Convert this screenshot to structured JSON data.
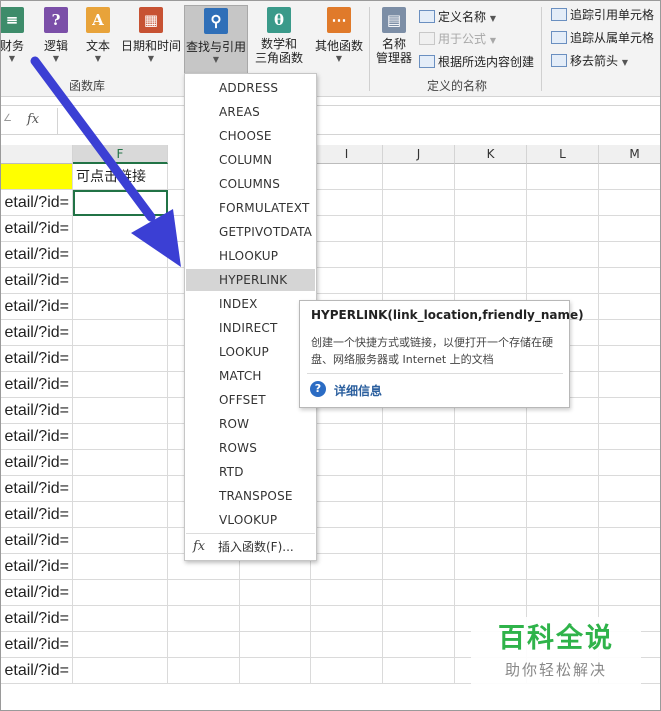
{
  "ribbon": {
    "finance_label": "财务",
    "logic_label": "逻辑",
    "text_label": "文本",
    "datetime_label": "日期和时间",
    "lookup_label": "查找与引用",
    "math_label_line1": "数学和",
    "math_label_line2": "三角函数",
    "more_label": "其他函数",
    "group_function_library": "函数库",
    "name_manager_line1": "名称",
    "name_manager_line2": "管理器",
    "define_name": "定义名称",
    "use_in_formula": "用于公式",
    "create_from_selection": "根据所选内容创建",
    "group_defined_names": "定义的名称",
    "trace_precedents": "追踪引用单元格",
    "trace_dependents": "追踪从属单元格",
    "remove_arrows": "移去箭头"
  },
  "formula_bar": {
    "fx_label": "fx"
  },
  "columns": [
    "F",
    "I",
    "J",
    "K",
    "L",
    "M"
  ],
  "header_cell": "可点击链接",
  "left_cell_text": "etail/?id=",
  "row_count": 20,
  "dropdown": {
    "items": [
      "ADDRESS",
      "AREAS",
      "CHOOSE",
      "COLUMN",
      "COLUMNS",
      "FORMULATEXT",
      "GETPIVOTDATA",
      "HLOOKUP",
      "HYPERLINK",
      "INDEX",
      "INDIRECT",
      "LOOKUP",
      "MATCH",
      "OFFSET",
      "ROW",
      "ROWS",
      "RTD",
      "TRANSPOSE",
      "VLOOKUP"
    ],
    "highlighted": "HYPERLINK",
    "insert_function": "插入函数(F)..."
  },
  "tooltip": {
    "title": "HYPERLINK(link_location,friendly_name)",
    "description": "创建一个快捷方式或链接，以便打开一个存储在硬盘、网络服务器或  Internet 上的文档",
    "more_info": "详细信息"
  },
  "watermark": {
    "main": "百科全说",
    "sub": "助你轻松解决"
  },
  "colors": {
    "accent_green": "#217346",
    "highlight_yellow": "#ffff00",
    "arrow_blue": "#3b3fd4",
    "watermark_green": "#2fb34a"
  }
}
